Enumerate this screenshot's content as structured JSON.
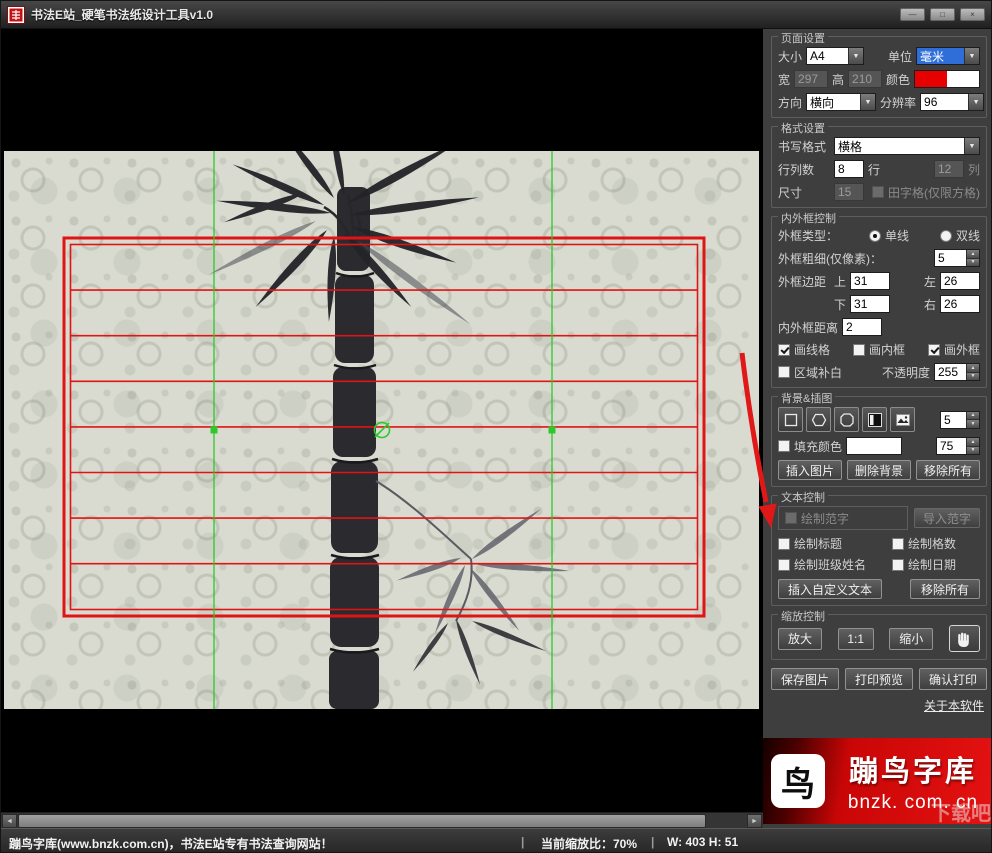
{
  "window": {
    "title": "书法E站_硬笔书法纸设计工具v1.0"
  },
  "icons": {
    "minimize": "—",
    "maximize": "□",
    "close": "×",
    "dropdown": "▼",
    "spin_up": "▲",
    "spin_down": "▼",
    "scroll_left": "◄",
    "scroll_right": "►"
  },
  "page_settings": {
    "title": "页面设置",
    "size_label": "大小",
    "size_value": "A4",
    "unit_label": "单位",
    "unit_value": "毫米",
    "width_label": "宽",
    "width_value": "297",
    "height_label": "高",
    "height_value": "210",
    "color_label": "颜色",
    "orientation_label": "方向",
    "orientation_value": "横向",
    "resolution_label": "分辨率",
    "resolution_value": "96"
  },
  "format_settings": {
    "title": "格式设置",
    "writing_format_label": "书写格式",
    "writing_format_value": "横格",
    "rowcol_label": "行列数",
    "rows_value": "8",
    "rows_suffix": "行",
    "cols_value": "12",
    "cols_suffix": "列",
    "cell_size_label": "尺寸",
    "cell_size_value": "15",
    "tianzige_label": "田字格(仅限方格)"
  },
  "frame_control": {
    "title": "内外框控制",
    "type_label": "外框类型：",
    "single_line": "单线",
    "double_line": "双线",
    "thickness_label": "外框粗细(仅像素)：",
    "thickness_value": "5",
    "margin_label": "外框边距",
    "top_label": "上",
    "top_value": "31",
    "left_label": "左",
    "left_value": "26",
    "bottom_label": "下",
    "bottom_value": "31",
    "right_label": "右",
    "right_value": "26",
    "gap_label": "内外框距离",
    "gap_value": "2",
    "draw_grid_label": "画线格",
    "draw_inner_label": "画内框",
    "draw_outer_label": "画外框",
    "padding_label": "区域补白",
    "opacity_label": "不透明度",
    "opacity_value": "255"
  },
  "background_panel": {
    "title": "背景&插图",
    "shape_count_value": "5",
    "fill_color_label": "填充颜色",
    "fill_value": "75",
    "insert_image_btn": "插入图片",
    "delete_bg_btn": "删除背景",
    "remove_all_btn": "移除所有"
  },
  "text_control": {
    "title": "文本控制",
    "draw_model_label": "绘制范字",
    "import_model_btn": "导入范字",
    "draw_title_label": "绘制标题",
    "draw_count_label": "绘制格数",
    "draw_class_label": "绘制班级姓名",
    "draw_date_label": "绘制日期",
    "insert_text_btn": "插入自定义文本",
    "remove_all_btn": "移除所有"
  },
  "zoom_control": {
    "title": "缩放控制",
    "zoom_in_btn": "放大",
    "actual_btn": "1:1",
    "zoom_out_btn": "缩小"
  },
  "actions": {
    "save_btn": "保存图片",
    "preview_btn": "打印预览",
    "print_btn": "确认打印"
  },
  "about_link": "关于本软件",
  "banner": {
    "brand": "蹦鸟字库",
    "url": "bnzk. com. cn",
    "logo_char": "鸟",
    "watermark": "下载吧"
  },
  "status_bar": {
    "site_text": "蹦鸟字库(www.bnzk.com.cn)，书法E站专有书法查询网站！",
    "separator": "|",
    "zoom_text": "当前缩放比：70%",
    "size_text": "W: 403 H: 51"
  }
}
